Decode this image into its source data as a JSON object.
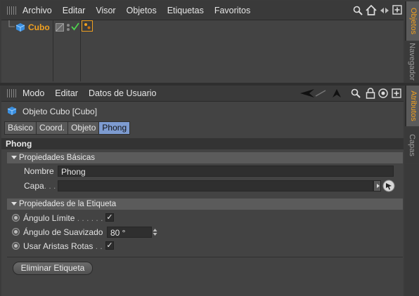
{
  "objects_panel": {
    "menu": [
      "Archivo",
      "Editar",
      "Visor",
      "Objetos",
      "Etiquetas",
      "Favoritos"
    ],
    "object_name": "Cubo"
  },
  "right_tabs_top": {
    "active": "Objetos",
    "other": "Navegador"
  },
  "right_tabs_bottom": {
    "active": "Atributos",
    "other": "Capas"
  },
  "attributes_panel": {
    "menu": [
      "Modo",
      "Editar",
      "Datos de Usuario"
    ],
    "object_title": "Objeto Cubo  [Cubo]",
    "tabs": [
      "Básico",
      "Coord.",
      "Objeto",
      "Phong"
    ],
    "active_tab": "Phong",
    "header": "Phong",
    "section_basic": "Propiedades Básicas",
    "nombre_label": "Nombre",
    "nombre_value": "Phong",
    "capa_label": "Capa",
    "capa_dots": ". . .",
    "section_tag": "Propiedades de la Etiqueta",
    "angulo_limite_label": "Ángulo Límite",
    "angulo_limite_dots": ". . . . . .",
    "angulo_limite_checked": true,
    "angulo_suavizado_label": "Ángulo de Suavizado",
    "angulo_suavizado_value": "80 °",
    "aristas_label": "Usar Aristas Rotas",
    "aristas_dots": ". .",
    "aristas_checked": true,
    "delete_button": "Eliminar Etiqueta"
  },
  "colors": {
    "accent_orange": "#f0a020",
    "tab_active": "#7d9bd0",
    "cube_blue": "#3a8fe0"
  },
  "icons": [
    "search-icon",
    "home-icon",
    "nav-arrows-icon",
    "expand-icon",
    "arrow-left-icon",
    "arrow-up-icon",
    "lock-icon",
    "target-icon",
    "plus-icon",
    "cube-icon",
    "phong-tag-icon",
    "checkmark-icon",
    "layer-select-icon"
  ]
}
